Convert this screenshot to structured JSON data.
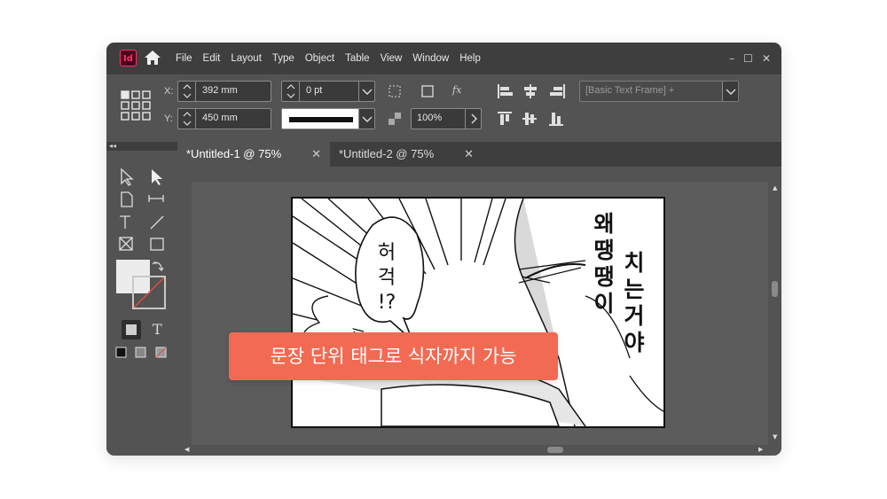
{
  "app": {
    "logo": "Id",
    "home_icon": "home-icon"
  },
  "menu": [
    "File",
    "Edit",
    "Layout",
    "Type",
    "Object",
    "Table",
    "View",
    "Window",
    "Help"
  ],
  "window_controls": {
    "minimize": "–",
    "maximize": "☐",
    "close": "✕"
  },
  "control_panel": {
    "x_label": "X:",
    "x_value": "392 mm",
    "y_label": "Y:",
    "y_value": "450 mm",
    "stroke_weight": "0 pt",
    "opacity": "100%",
    "fx_label": "fx",
    "object_style": "[Basic Text Frame] +"
  },
  "tabs": [
    {
      "label": "*Untitled-1 @ 75%",
      "active": true
    },
    {
      "label": "*Untitled-2 @ 75%",
      "active": false
    }
  ],
  "tab_close": "✕",
  "panel_collapse": "◂◂",
  "tools": {
    "type_label": "T",
    "text_tool_label": "T"
  },
  "comic": {
    "bubble_line1": "허",
    "bubble_line2": "걱",
    "bubble_line3": "!?",
    "right_col_1": [
      "왜",
      "땡",
      "땡",
      "이"
    ],
    "right_col_2": [
      "치",
      "는",
      "거",
      "야"
    ]
  },
  "banner_text": "문장 단위 태그로 식자까지 가능",
  "colors": {
    "accent": "#f26a52",
    "chrome_dark": "#3e3e3e",
    "chrome": "#535353",
    "app_logo": "#ff3366"
  }
}
